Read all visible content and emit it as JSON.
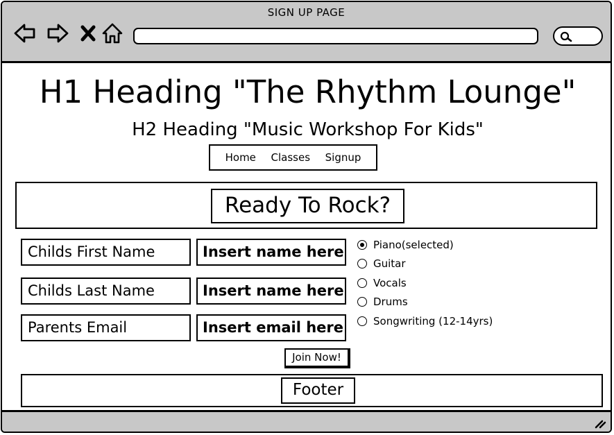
{
  "window": {
    "title": "SIGN UP PAGE"
  },
  "browser": {
    "icons": [
      "back-arrow-icon",
      "forward-arrow-icon",
      "close-icon",
      "home-icon",
      "search-icon",
      "resize-grip-icon"
    ],
    "url": ""
  },
  "page": {
    "h1": "H1 Heading \"The Rhythm Lounge\"",
    "h2": "H2 Heading \"Music Workshop For Kids\"",
    "nav": [
      "Home",
      "Classes",
      "Signup"
    ],
    "hero": "Ready To Rock?",
    "form": {
      "fields": [
        {
          "label": "Childs First Name",
          "placeholder": "Insert name here"
        },
        {
          "label": "Childs Last Name",
          "placeholder": "Insert name here"
        },
        {
          "label": "Parents Email",
          "placeholder": "Insert email here"
        }
      ],
      "options": [
        {
          "label": "Piano(selected)",
          "selected": true
        },
        {
          "label": "Guitar",
          "selected": false
        },
        {
          "label": "Vocals",
          "selected": false
        },
        {
          "label": "Drums",
          "selected": false
        },
        {
          "label": "Songwriting (12-14yrs)",
          "selected": false
        }
      ],
      "submit": "Join Now!"
    },
    "footer": "Footer"
  },
  "colors": {
    "chrome": "#c8c8c8",
    "background": "#ffffff",
    "ink": "#000000"
  }
}
